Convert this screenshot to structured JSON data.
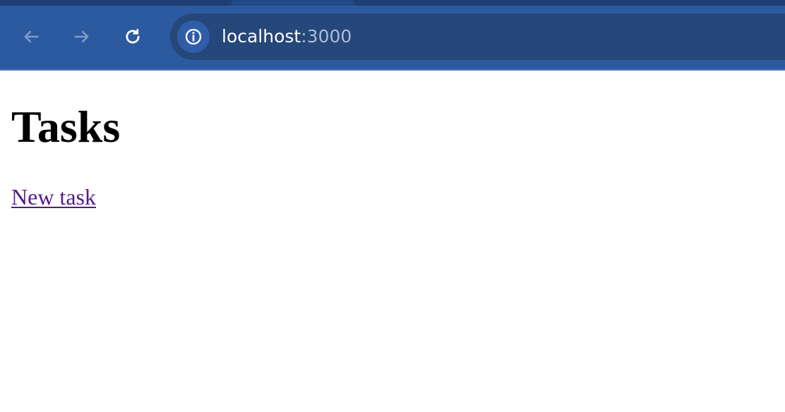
{
  "browser": {
    "toolbar": {
      "back_icon": "arrow-left-icon",
      "forward_icon": "arrow-right-icon",
      "reload_icon": "reload-icon",
      "site_info_icon": "info-circle-icon"
    },
    "address_bar": {
      "host": "localhost",
      "port": ":3000"
    },
    "colors": {
      "toolbar_background": "#2c5aa0",
      "omnibox_background": "#25477a",
      "url_text": "#ffffff",
      "port_text": "#a9bcdc",
      "link_visited": "#551a8b"
    }
  },
  "page": {
    "title": "Tasks",
    "new_task_link": "New task"
  }
}
